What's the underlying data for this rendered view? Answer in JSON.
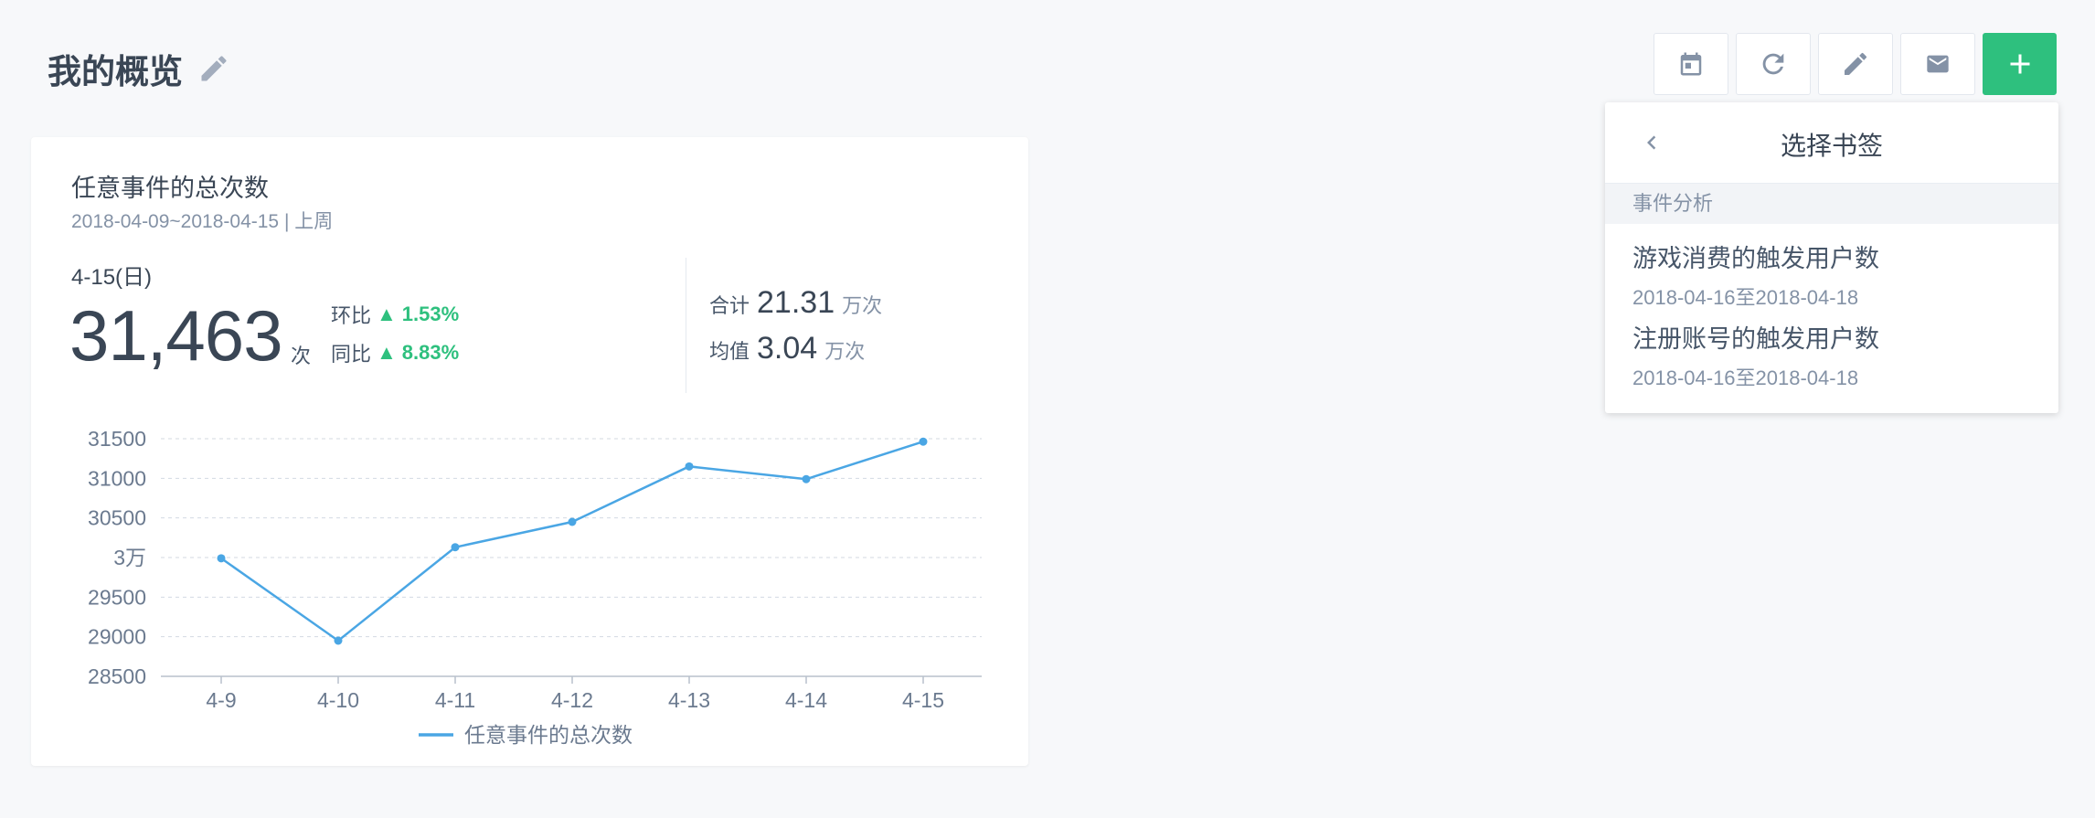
{
  "page": {
    "title": "我的概览"
  },
  "toolbar": {
    "buttons": [
      {
        "name": "calendar",
        "icon": "calendar-icon"
      },
      {
        "name": "refresh",
        "icon": "refresh-icon"
      },
      {
        "name": "edit",
        "icon": "pencil-icon"
      },
      {
        "name": "mail",
        "icon": "mail-icon"
      },
      {
        "name": "add",
        "icon": "plus-icon"
      }
    ]
  },
  "colors": {
    "accent": "#2ec07e",
    "series": "#4aa6e4",
    "up": "#2ec07e"
  },
  "card": {
    "title": "任意事件的总次数",
    "subtitle": "2018-04-09~2018-04-15 | 上周",
    "day_label": "4-15(日)",
    "big_value": "31,463",
    "big_unit": "次",
    "compare": [
      {
        "label": "环比",
        "value": "1.53%"
      },
      {
        "label": "同比",
        "value": "8.83%"
      }
    ],
    "summary": [
      {
        "label": "合计",
        "value": "21.31",
        "unit": "万次"
      },
      {
        "label": "均值",
        "value": "3.04",
        "unit": "万次"
      }
    ]
  },
  "chart_data": {
    "type": "line",
    "categories": [
      "4-9",
      "4-10",
      "4-11",
      "4-12",
      "4-13",
      "4-14",
      "4-15"
    ],
    "series": [
      {
        "name": "任意事件的总次数",
        "values": [
          29990,
          28950,
          30130,
          30450,
          31150,
          30990,
          31463
        ]
      }
    ],
    "ylim": [
      28500,
      31500
    ],
    "yticks": [
      {
        "value": 31500,
        "label": "31500"
      },
      {
        "value": 31000,
        "label": "31000"
      },
      {
        "value": 30500,
        "label": "30500"
      },
      {
        "value": 30000,
        "label": "3万"
      },
      {
        "value": 29500,
        "label": "29500"
      },
      {
        "value": 29000,
        "label": "29000"
      },
      {
        "value": 28500,
        "label": "28500"
      }
    ],
    "grid": true,
    "legend_position": "bottom-center"
  },
  "dropdown": {
    "title": "选择书签",
    "section": "事件分析",
    "items": [
      {
        "title": "游戏消费的触发用户数",
        "date": "2018-04-16至2018-04-18"
      },
      {
        "title": "注册账号的触发用户数",
        "date": "2018-04-16至2018-04-18"
      }
    ]
  }
}
